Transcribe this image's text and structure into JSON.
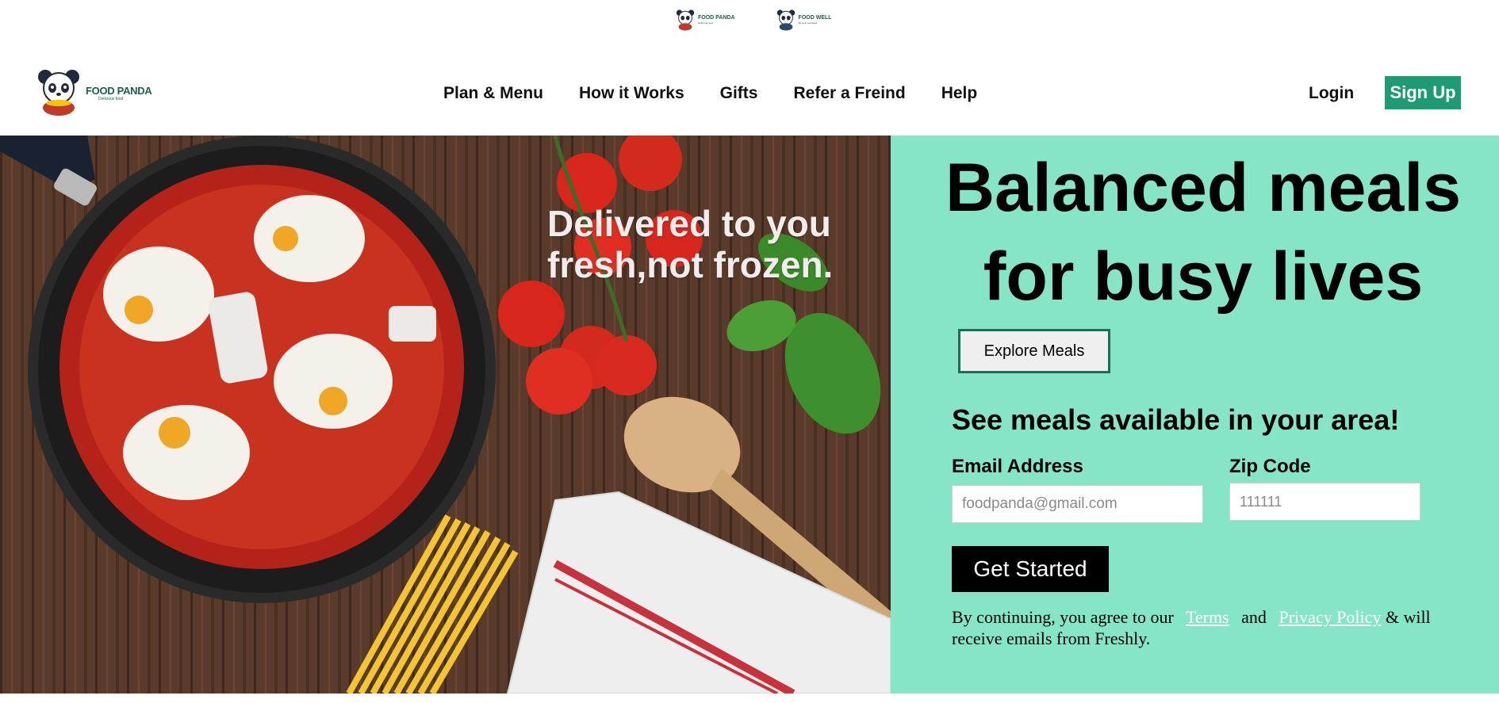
{
  "mini_logos": [
    {
      "name": "FOOD PANDA",
      "tagline": "Delicious food"
    },
    {
      "name": "FOOD WELL",
      "tagline": "Be well nourished"
    }
  ],
  "brand": {
    "name": "FOOD PANDA",
    "tagline": "Delicious food"
  },
  "nav": {
    "items": [
      "Plan & Menu",
      "How it Works",
      "Gifts",
      "Refer a Freind",
      "Help"
    ],
    "login": "Login",
    "signup": "Sign Up"
  },
  "hero": {
    "caption": "Delivered to you fresh,not frozen.",
    "headline": "Balanced meals for busy lives",
    "explore_button": "Explore Meals",
    "area_title": "See meals available in your area!",
    "email_label": "Email Address",
    "email_placeholder": "foodpanda@gmail.com",
    "zip_label": "Zip Code",
    "zip_placeholder": "111111",
    "cta": "Get Started",
    "legal_prefix": "By continuing, you agree to our",
    "terms": "Terms",
    "and": "and",
    "privacy": "Privacy Policy",
    "legal_suffix": "& will receive emails from Freshly."
  },
  "colors": {
    "panel": "#86e5c6",
    "brand_green": "#1f9b73",
    "dark_green": "#1b5e4a"
  }
}
